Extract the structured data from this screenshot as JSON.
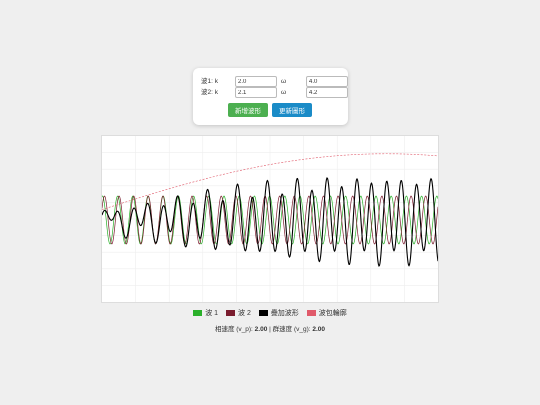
{
  "controls": {
    "wave1": {
      "label": "波1: k",
      "k": "2.0",
      "omega_label": "ω",
      "omega": "4.0"
    },
    "wave2": {
      "label": "波2: k",
      "k": "2.1",
      "omega_label": "ω",
      "omega": "4.2"
    },
    "add_button": "新增波形",
    "update_button": "更新圖形"
  },
  "colors": {
    "wave1": "#2ab02a",
    "wave2": "#7a1c2e",
    "sum": "#000000",
    "envelope": "#e05a6a",
    "add_button": "#4caf50",
    "update_button": "#1a8bc7"
  },
  "chart_data": {
    "type": "line",
    "grid": true,
    "title": "",
    "xlabel": "",
    "ylabel": "",
    "series": [
      {
        "name": "波 1",
        "k": 2.0,
        "omega": 4.0,
        "amplitude": 1
      },
      {
        "name": "波 2",
        "k": 2.1,
        "omega": 4.2,
        "amplitude": 1
      },
      {
        "name": "疊加波形"
      },
      {
        "name": "波包輪廓"
      }
    ]
  },
  "legend": [
    {
      "label": "波 1",
      "color": "#2ab02a"
    },
    {
      "label": "波 2",
      "color": "#7a1c2e"
    },
    {
      "label": "疊加波形",
      "color": "#000000"
    },
    {
      "label": "波包輪廓",
      "color": "#e05a6a"
    }
  ],
  "speeds": {
    "phase_label": "相速度 (v_p):",
    "phase_value": "2.00",
    "separator": "|",
    "group_label": "群速度 (v_g):",
    "group_value": "2.00"
  }
}
